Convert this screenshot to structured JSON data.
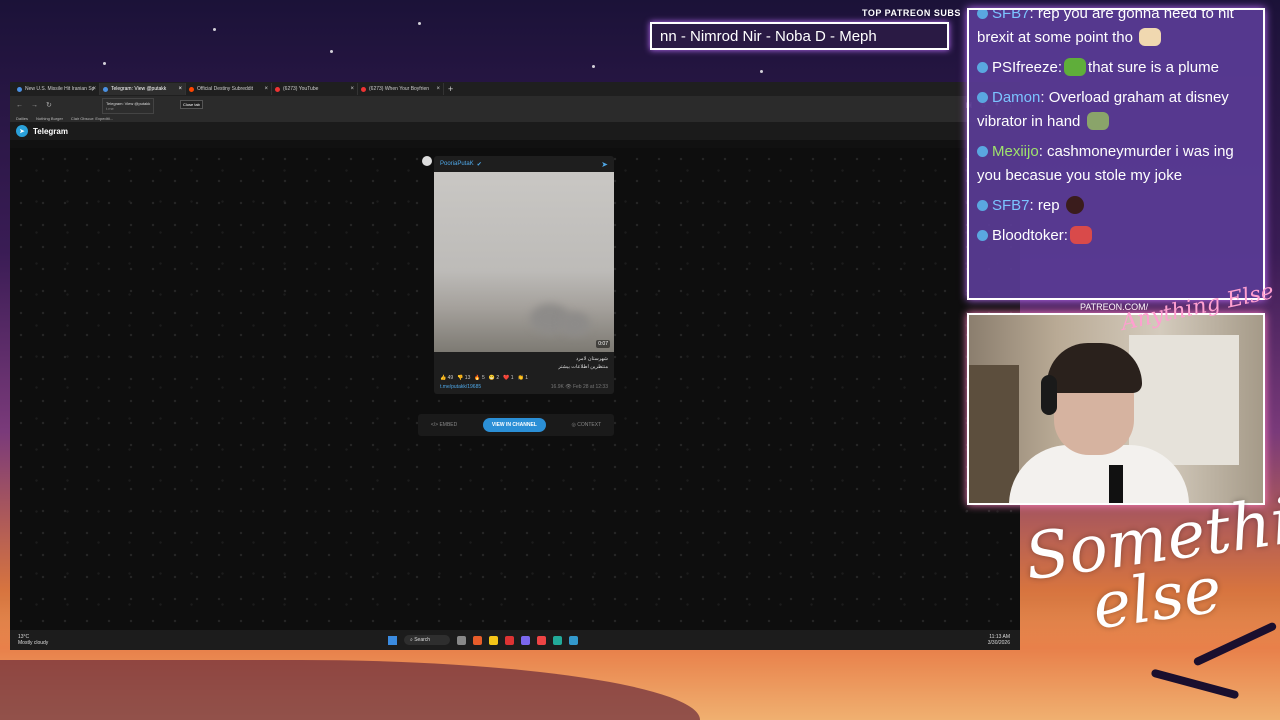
{
  "patreon_ticker": {
    "label": "TOP PATREON SUBS",
    "text": "nn - Nimrod Nir - Noba D - Meph"
  },
  "browser": {
    "tabs": [
      {
        "label": "New U.S. Missile Hit Iranian Sp"
      },
      {
        "label": "Telegram: View @putakk"
      },
      {
        "label": "Official Destiny Subreddit"
      },
      {
        "label": "(6273) YouTube"
      },
      {
        "label": "(6273) When Your Boyfrien"
      }
    ],
    "tooltip_title": "Telegram: View @putakk",
    "tooltip_sub": "t.me",
    "close_tip": "Close tab",
    "bookmarks": [
      "Dailies",
      "Nothing Burger",
      "Clair Obscur: Expediti..."
    ]
  },
  "telegram": {
    "app_name": "Telegram",
    "channel": "PooriaPutaK",
    "duration": "0:07",
    "caption_line1": "شهرستان لامرد",
    "caption_line2": "منتظرین اطلاعات بیشتر",
    "reactions": [
      "👍 49",
      "👎 13",
      "🔥 5",
      "😁 2",
      "❤️ 1",
      "👏 1"
    ],
    "link": "t.me/putakk/19685",
    "meta": "16.9K 👁 Feb 28 at 12:33",
    "embed_label": "EMBED",
    "view_label": "VIEW IN CHANNEL",
    "context_label": "CONTEXT"
  },
  "taskbar": {
    "temp": "13°C",
    "weather": "Mostly cloudy",
    "search": "Search",
    "time": "11:13 AM",
    "date": "3/30/2026"
  },
  "chat": {
    "messages": [
      {
        "user": "SFB7",
        "text": "rep you are gonna need to hit brexit at some point tho",
        "user_color": "blue"
      },
      {
        "user": "PSIfreeze",
        "text": "that sure is a plume",
        "user_color": "white"
      },
      {
        "user": "Damon",
        "text": "Overload graham at disney vibrator in hand",
        "user_color": "blue"
      },
      {
        "user": "Mexiijo",
        "text": "cashmoneymurder i was ing you becasue you stole my joke",
        "user_color": "green"
      },
      {
        "user": "SFB7",
        "text": "rep",
        "user_color": "blue"
      },
      {
        "user": "Bloodtoker",
        "text": "",
        "user_color": "white"
      }
    ]
  },
  "branding": {
    "patreon_url": "PATREON.COM/",
    "overlay_word": "Anything Else",
    "logo_line1": "Something",
    "logo_line2": "else"
  },
  "colors": {
    "accent_purple": "#c070ff",
    "telegram_blue": "#2aa1da",
    "chat_bg": "#5a3c96"
  }
}
